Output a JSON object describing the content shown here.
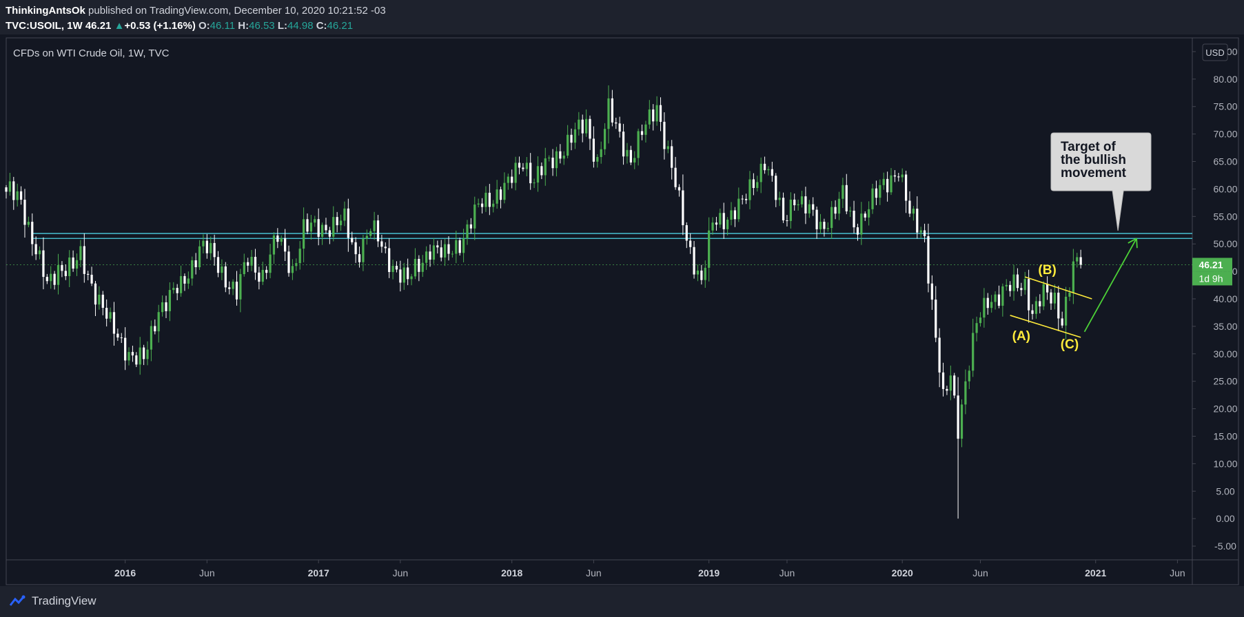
{
  "header": {
    "author": "ThinkingAntsOk",
    "published": "published on TradingView.com, December 10, 2020 10:21:52 -03",
    "symbol": "TVC:USOIL, 1W",
    "last": "46.21",
    "change_arrow": "▲",
    "change": "+0.53 (+1.16%)",
    "open_label": "O:",
    "open": "46.11",
    "high_label": "H:",
    "high": "46.53",
    "low_label": "L:",
    "low": "44.98",
    "close_label": "C:",
    "close": "46.21"
  },
  "colors": {
    "background": "#131722",
    "up_candle": "#4caf50",
    "down_candle": "#ffffff",
    "resistance_line": "#4dd0e1",
    "annotation_yellow": "#ffeb3b",
    "arrow_green": "#4cd137",
    "price_tag": "#4caf50"
  },
  "chart_data": {
    "type": "candlestick",
    "title": "CFDs on WTI Crude Oil, 1W, TVC",
    "currency": "USD",
    "x_start": "2015-05-25",
    "x_end": "2021-07-05",
    "ylim": [
      -7.5,
      87.5
    ],
    "y_ticks": [
      "85.00",
      "80.00",
      "75.00",
      "70.00",
      "65.00",
      "60.00",
      "55.00",
      "50.00",
      "45.00",
      "40.00",
      "35.00",
      "30.00",
      "25.00",
      "20.00",
      "15.00",
      "10.00",
      "5.00",
      "0.00",
      "-5.00"
    ],
    "x_ticks": [
      {
        "label": "2016",
        "date": "2016-01-04",
        "bold": true
      },
      {
        "label": "Jun",
        "date": "2016-06-06",
        "bold": false
      },
      {
        "label": "2017",
        "date": "2017-01-02",
        "bold": true
      },
      {
        "label": "Jun",
        "date": "2017-06-05",
        "bold": false
      },
      {
        "label": "2018",
        "date": "2018-01-01",
        "bold": true
      },
      {
        "label": "Jun",
        "date": "2018-06-04",
        "bold": false
      },
      {
        "label": "2019",
        "date": "2019-01-07",
        "bold": true
      },
      {
        "label": "Jun",
        "date": "2019-06-03",
        "bold": false
      },
      {
        "label": "2020",
        "date": "2020-01-06",
        "bold": true
      },
      {
        "label": "Jun",
        "date": "2020-06-01",
        "bold": false
      },
      {
        "label": "2021",
        "date": "2021-01-04",
        "bold": true
      },
      {
        "label": "Jun",
        "date": "2021-06-07",
        "bold": false
      }
    ],
    "current_price": {
      "value": 46.21,
      "label": "46.21",
      "countdown": "1d 9h"
    },
    "resistance_zone": [
      51.0,
      51.9
    ],
    "closes": [
      {
        "date": "2015-05-25",
        "close": 59.5
      },
      {
        "date": "2015-06-22",
        "close": 58.3
      },
      {
        "date": "2015-07-20",
        "close": 48.5
      },
      {
        "date": "2015-08-10",
        "close": 42.3
      },
      {
        "date": "2015-08-31",
        "close": 46.0
      },
      {
        "date": "2015-09-28",
        "close": 45.5
      },
      {
        "date": "2015-10-12",
        "close": 47.5
      },
      {
        "date": "2015-11-02",
        "close": 43.0
      },
      {
        "date": "2015-12-07",
        "close": 35.0
      },
      {
        "date": "2016-01-18",
        "close": 29.5
      },
      {
        "date": "2016-02-08",
        "close": 28.5
      },
      {
        "date": "2016-03-07",
        "close": 38.5
      },
      {
        "date": "2016-04-18",
        "close": 42.0
      },
      {
        "date": "2016-05-23",
        "close": 49.5
      },
      {
        "date": "2016-06-06",
        "close": 49.0
      },
      {
        "date": "2016-08-01",
        "close": 41.0
      },
      {
        "date": "2016-08-22",
        "close": 47.0
      },
      {
        "date": "2016-09-19",
        "close": 44.5
      },
      {
        "date": "2016-10-17",
        "close": 51.0
      },
      {
        "date": "2016-11-14",
        "close": 45.5
      },
      {
        "date": "2016-12-05",
        "close": 52.5
      },
      {
        "date": "2017-01-02",
        "close": 53.0
      },
      {
        "date": "2017-02-20",
        "close": 54.0
      },
      {
        "date": "2017-03-13",
        "close": 48.0
      },
      {
        "date": "2017-04-10",
        "close": 53.0
      },
      {
        "date": "2017-05-08",
        "close": 48.0
      },
      {
        "date": "2017-06-19",
        "close": 43.0
      },
      {
        "date": "2017-07-31",
        "close": 49.5
      },
      {
        "date": "2017-08-28",
        "close": 47.5
      },
      {
        "date": "2017-10-02",
        "close": 51.5
      },
      {
        "date": "2017-11-06",
        "close": 57.5
      },
      {
        "date": "2017-12-25",
        "close": 60.5
      },
      {
        "date": "2018-01-22",
        "close": 65.5
      },
      {
        "date": "2018-02-12",
        "close": 61.5
      },
      {
        "date": "2018-03-19",
        "close": 65.5
      },
      {
        "date": "2018-05-21",
        "close": 72.0
      },
      {
        "date": "2018-06-11",
        "close": 65.0
      },
      {
        "date": "2018-07-02",
        "close": 74.0
      },
      {
        "date": "2018-08-13",
        "close": 65.5
      },
      {
        "date": "2018-10-01",
        "close": 75.5
      },
      {
        "date": "2018-10-29",
        "close": 63.5
      },
      {
        "date": "2018-11-26",
        "close": 51.0
      },
      {
        "date": "2018-12-24",
        "close": 43.0
      },
      {
        "date": "2019-01-14",
        "close": 53.5
      },
      {
        "date": "2019-03-11",
        "close": 57.0
      },
      {
        "date": "2019-04-22",
        "close": 65.5
      },
      {
        "date": "2019-05-27",
        "close": 54.0
      },
      {
        "date": "2019-06-17",
        "close": 59.0
      },
      {
        "date": "2019-08-05",
        "close": 53.0
      },
      {
        "date": "2019-09-16",
        "close": 58.5
      },
      {
        "date": "2019-10-07",
        "close": 53.0
      },
      {
        "date": "2019-11-04",
        "close": 57.0
      },
      {
        "date": "2019-12-30",
        "close": 64.0
      },
      {
        "date": "2020-01-20",
        "close": 55.0
      },
      {
        "date": "2020-02-17",
        "close": 51.5
      },
      {
        "date": "2020-03-09",
        "close": 33.0
      },
      {
        "date": "2020-03-23",
        "close": 21.0
      },
      {
        "date": "2020-04-06",
        "close": 26.0
      },
      {
        "date": "2020-04-20",
        "close": 17.0
      },
      {
        "date": "2020-05-04",
        "close": 25.0
      },
      {
        "date": "2020-05-25",
        "close": 35.0
      },
      {
        "date": "2020-06-15",
        "close": 40.0
      },
      {
        "date": "2020-07-20",
        "close": 41.5
      },
      {
        "date": "2020-08-24",
        "close": 43.0
      },
      {
        "date": "2020-09-07",
        "close": 37.5
      },
      {
        "date": "2020-09-28",
        "close": 40.5
      },
      {
        "date": "2020-10-19",
        "close": 40.0
      },
      {
        "date": "2020-11-02",
        "close": 36.5
      },
      {
        "date": "2020-11-23",
        "close": 45.5
      },
      {
        "date": "2020-12-07",
        "close": 46.21
      }
    ],
    "annotations": [
      {
        "type": "callout",
        "text": [
          "Target of",
          "the bullish",
          "movement"
        ]
      },
      {
        "type": "wave_label",
        "text": "(A)"
      },
      {
        "type": "wave_label",
        "text": "(B)"
      },
      {
        "type": "wave_label",
        "text": "(C)"
      }
    ]
  },
  "footer": {
    "brand": "TradingView"
  }
}
